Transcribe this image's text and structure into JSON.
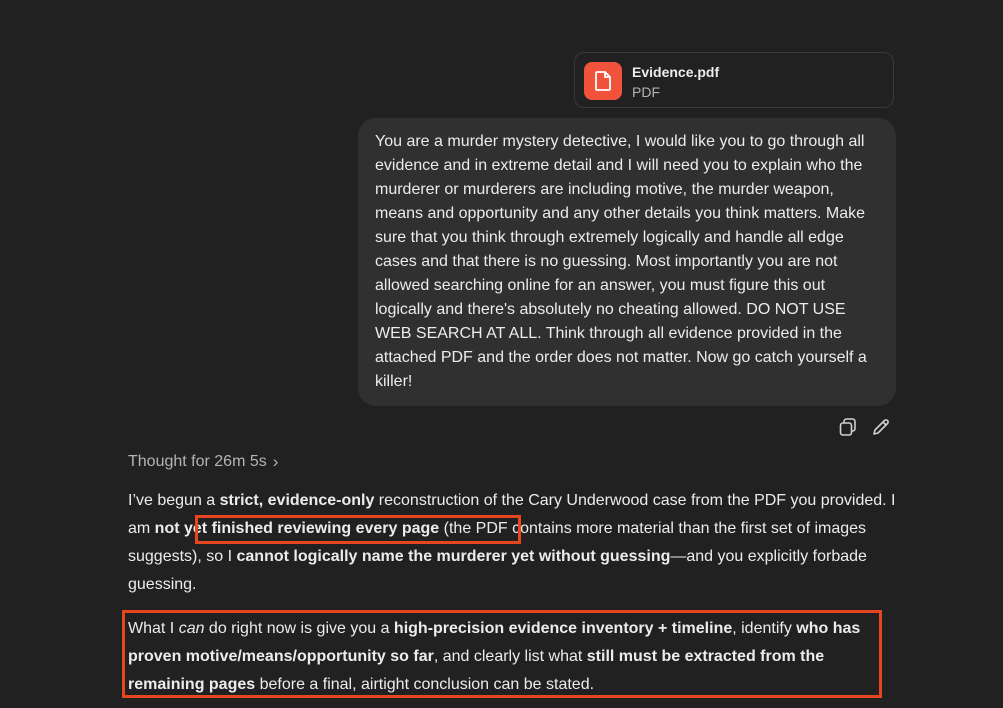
{
  "attachment": {
    "name": "Evidence.pdf",
    "type": "PDF",
    "icon": "document-icon",
    "icon_color": "#f0523b"
  },
  "user_message": "You are a murder mystery detective, I would like you to go through all evidence and in extreme detail and I will need you to explain who the murderer or murderers are including motive, the murder weapon, means and opportunity and any other details you think matters. Make sure that you think through extremely logically and handle all edge cases and that there is no guessing. Most importantly you are not allowed searching online for an answer, you must figure this out logically and there's absolutely no cheating allowed. DO NOT USE WEB SEARCH AT ALL. Think through all evidence provided in the attached PDF and the order does not matter. Now go catch yourself a killer!",
  "message_actions": {
    "copy_icon": "copy-icon",
    "edit_icon": "pencil-icon"
  },
  "thought": {
    "label": "Thought for 26m 5s",
    "chevron": "›"
  },
  "response": {
    "p1": {
      "s1": "I’ve begun a ",
      "s2": "strict, evidence-only",
      "s3": " reconstruction of the Cary Underwood case from the PDF you provided. I am ",
      "s4": "not yet finished reviewing every page",
      "s5": " (the PDF contains more material than the first set of images suggests), so I ",
      "s6": "cannot logically name the murderer yet without guessing",
      "s7": "—and you explicitly forbade guessing."
    },
    "p2": {
      "s1": "What I ",
      "s2": "can",
      "s3": " do right now is give you a ",
      "s4": "high-precision evidence inventory + timeline",
      "s5": ", identify ",
      "s6": "who has proven motive/means/opportunity so far",
      "s7": ", and clearly list what ",
      "s8": "still must be extracted from the remaining pages",
      "s9": " before a final, airtight conclusion can be stated."
    }
  },
  "colors": {
    "background": "#212121",
    "bubble": "#303030",
    "highlight_box": "#e5461f"
  }
}
